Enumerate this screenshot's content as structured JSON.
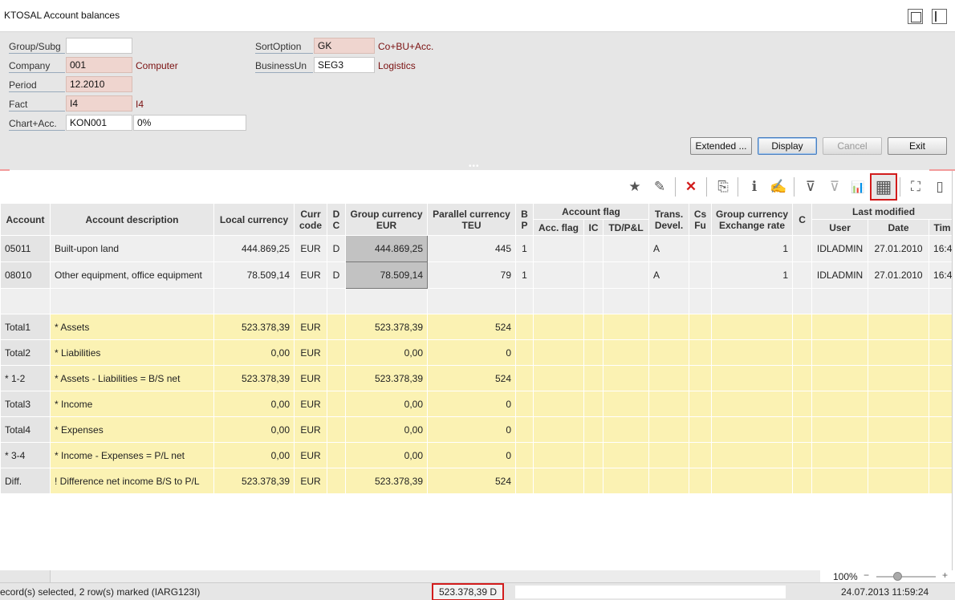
{
  "window": {
    "title": "KTOSAL Account balances"
  },
  "form": {
    "group_subg": {
      "label": "Group/Subg",
      "value": ""
    },
    "company": {
      "label": "Company",
      "value": "001",
      "desc": "Computer"
    },
    "period": {
      "label": "Period",
      "value": "12.2010"
    },
    "fact": {
      "label": "Fact",
      "value": "I4",
      "desc": "I4"
    },
    "chart_acc": {
      "label": "Chart+Acc.",
      "value": "KON001",
      "value2": "0%"
    },
    "sort_option": {
      "label": "SortOption",
      "value": "GK",
      "desc": "Co+BU+Acc."
    },
    "business_un": {
      "label": "BusinessUn",
      "value": "SEG3",
      "desc": "Logistics"
    }
  },
  "buttons": {
    "extended": "Extended ...",
    "display": "Display",
    "cancel": "Cancel",
    "exit": "Exit"
  },
  "splitter": {
    "dots": "•••"
  },
  "toolbar": {
    "favorite": "★",
    "edit": "✎",
    "delete": "✕",
    "copy": "⎘",
    "info": "ℹ",
    "edit_doc": "✍",
    "filter": "⊽",
    "filter_clear": "⊽",
    "chart": "📊",
    "grid": "▦",
    "maximize": "⛶",
    "panel": "▯"
  },
  "columns": {
    "account": "Account",
    "description": "Account description",
    "local": "Local currency",
    "curr_1": "Curr",
    "curr_2": "code",
    "dc_1": "D",
    "dc_2": "C",
    "group_1": "Group currency",
    "group_2": "EUR",
    "parallel_1": "Parallel currency",
    "parallel_2": "TEU",
    "bp_1": "B",
    "bp_2": "P",
    "account_flag": "Account flag",
    "acc_flag": "Acc. flag",
    "ic": "IC",
    "tdpl": "TD/P&L",
    "trans_1": "Trans.",
    "trans_2": "Devel.",
    "csfu_1": "Cs",
    "csfu_2": "Fu",
    "rate_1": "Group currency",
    "rate_2": "Exchange rate",
    "c": "C",
    "last_modified": "Last modified",
    "user": "User",
    "date": "Date",
    "time": "Tim"
  },
  "rows": [
    {
      "account": "05011",
      "description": "Built-upon land",
      "local": "444.869,25",
      "curr": "EUR",
      "dc": "D",
      "group": "444.869,25",
      "parallel": "445",
      "bp": "1",
      "acc_flag": "",
      "ic": "",
      "tdpl": "",
      "trans": "A",
      "csfu": "",
      "rate": "1",
      "c": "",
      "user": "IDLADMIN",
      "date": "27.01.2010",
      "time": "16:4"
    },
    {
      "account": "08010",
      "description": "Other equipment, office equipment",
      "local": "78.509,14",
      "curr": "EUR",
      "dc": "D",
      "group": "78.509,14",
      "parallel": "79",
      "bp": "1",
      "acc_flag": "",
      "ic": "",
      "tdpl": "",
      "trans": "A",
      "csfu": "",
      "rate": "1",
      "c": "",
      "user": "IDLADMIN",
      "date": "27.01.2010",
      "time": "16:4"
    }
  ],
  "totals": [
    {
      "account": "Total1",
      "description": "* Assets",
      "local": "523.378,39",
      "curr": "EUR",
      "group": "523.378,39",
      "parallel": "524"
    },
    {
      "account": "Total2",
      "description": "* Liabilities",
      "local": "0,00",
      "curr": "EUR",
      "group": "0,00",
      "parallel": "0"
    },
    {
      "account": "* 1-2",
      "description": "* Assets - Liabilities    = B/S net",
      "local": "523.378,39",
      "curr": "EUR",
      "group": "523.378,39",
      "parallel": "524"
    },
    {
      "account": "Total3",
      "description": "* Income",
      "local": "0,00",
      "curr": "EUR",
      "group": "0,00",
      "parallel": "0"
    },
    {
      "account": "Total4",
      "description": "* Expenses",
      "local": "0,00",
      "curr": "EUR",
      "group": "0,00",
      "parallel": "0"
    },
    {
      "account": "* 3-4",
      "description": "* Income - Expenses      = P/L net",
      "local": "0,00",
      "curr": "EUR",
      "group": "0,00",
      "parallel": "0"
    },
    {
      "account": "Diff.",
      "description": "! Difference net income B/S to P/L",
      "local": "523.378,39",
      "curr": "EUR",
      "group": "523.378,39",
      "parallel": "524"
    }
  ],
  "zoom": {
    "level": "100%",
    "minus": "−",
    "plus": "+",
    "value": 0.33
  },
  "status": {
    "message": "ecord(s) selected, 2 row(s) marked (IARG123I)",
    "sum": "523.378,39 D",
    "datetime": "24.07.2013 11:59:24"
  }
}
